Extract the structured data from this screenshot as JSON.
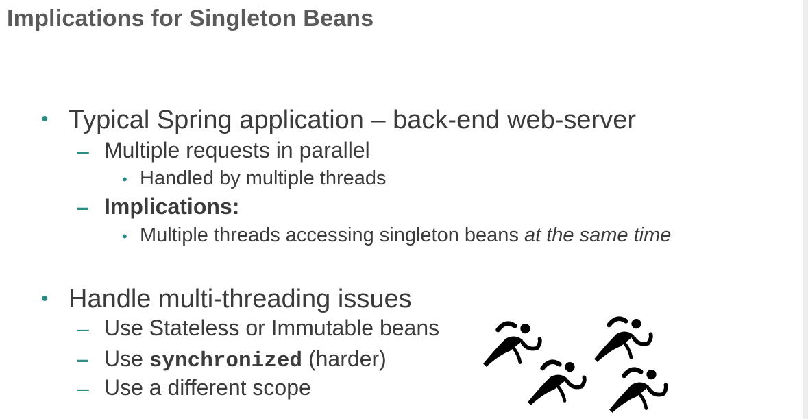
{
  "title": "Implications for Singleton Beans",
  "section1": {
    "heading": "Typical Spring application – back-end web-server",
    "sub1": "Multiple requests in parallel",
    "sub1_detail": "Handled by multiple threads",
    "sub2": "Implications:",
    "sub2_detail_prefix": "Multiple threads accessing singleton beans ",
    "sub2_detail_emphasis": "at the same time"
  },
  "section2": {
    "heading": "Handle multi-threading issues",
    "item1": "Use Stateless or Immutable beans",
    "item2_prefix": "Use ",
    "item2_code": "synchronized",
    "item2_suffix": " (harder)",
    "item3": "Use a different scope"
  },
  "markers": {
    "bullet": "•",
    "dash": "–"
  },
  "decoration": {
    "icon": "runner-icon",
    "count": 4,
    "color": "#000000"
  },
  "colors": {
    "accent": "#2f8d86",
    "title": "#5a5a5a",
    "text": "#3b3b3b"
  }
}
